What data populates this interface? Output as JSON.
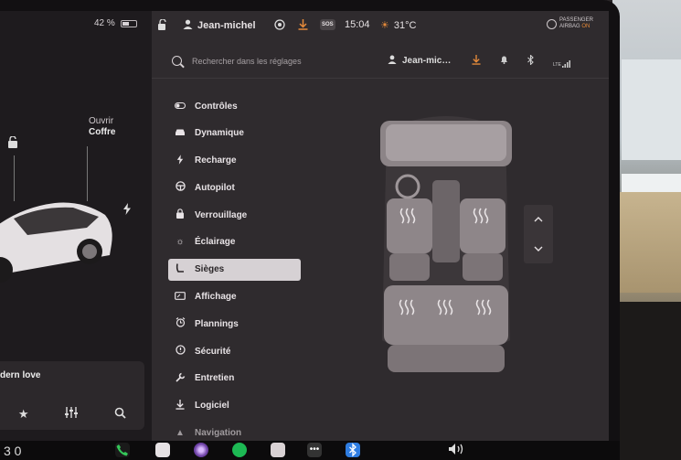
{
  "status": {
    "battery": "42 %",
    "user": "Jean-michel",
    "time": "15:04",
    "temperature": "31°C",
    "sos": "SOS",
    "airbag_line1": "PASSENGER",
    "airbag_line2": "AIRBAG",
    "airbag_state": "ON"
  },
  "left": {
    "trunk_action": "Ouvrir",
    "trunk_label": "Coffre",
    "media_title": "dern love"
  },
  "search": {
    "placeholder": "Rechercher dans les réglages",
    "user": "Jean-mic…",
    "lte": "LTE"
  },
  "menu": {
    "items": [
      {
        "label": "Contrôles",
        "icon": "toggle-icon"
      },
      {
        "label": "Dynamique",
        "icon": "car-icon"
      },
      {
        "label": "Recharge",
        "icon": "bolt-icon"
      },
      {
        "label": "Autopilot",
        "icon": "steering-wheel-icon"
      },
      {
        "label": "Verrouillage",
        "icon": "lock-icon"
      },
      {
        "label": "Éclairage",
        "icon": "sun-icon"
      },
      {
        "label": "Sièges",
        "icon": "seat-icon"
      },
      {
        "label": "Affichage",
        "icon": "display-icon"
      },
      {
        "label": "Plannings",
        "icon": "alarm-icon"
      },
      {
        "label": "Sécurité",
        "icon": "shield-icon"
      },
      {
        "label": "Entretien",
        "icon": "wrench-icon"
      },
      {
        "label": "Logiciel",
        "icon": "download-icon"
      },
      {
        "label": "Navigation",
        "icon": "navigation-icon"
      }
    ]
  },
  "taskbar": {
    "left_text": "3 0",
    "volume_icon": "speaker-icon"
  },
  "colors": {
    "accent": "#e58a3a",
    "active_bg": "#d6d1d4",
    "panel": "#2f2b2e"
  }
}
